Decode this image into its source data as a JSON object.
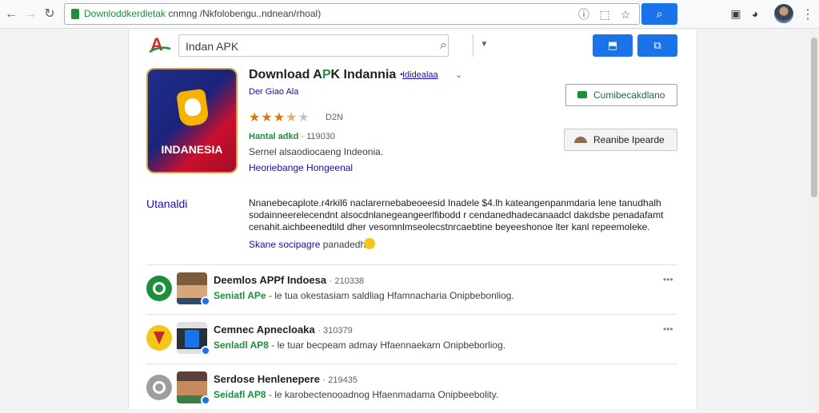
{
  "browser": {
    "url_host": "Downloddkerdletak",
    "url_path": " cnmng /Nkfolobengu..ndnean/rhoal)",
    "icons": [
      "back-arrow-icon",
      "forward-arrow-icon",
      "reload-icon",
      "security-lock-icon",
      "info-icon",
      "bookmark-icon",
      "star-icon",
      "search-icon",
      "extension-icon",
      "clock-icon",
      "profile-avatar",
      "menu-dots-icon"
    ]
  },
  "site": {
    "logo": "A",
    "search_value": "Indan APK",
    "colors": {
      "accent": "#1a73e8",
      "green": "#1e8e3e",
      "link": "#1a0dab",
      "star": "#e37400"
    }
  },
  "app": {
    "title_prefix": "Download A",
    "title_green": "P",
    "title_suffix": "K Indannia ·",
    "developer_link": "Ididealaa",
    "subtitle_link": "Der Giao Ala",
    "icon_text": "INDANESIA",
    "rating": 3.5,
    "rating_text": "D2N",
    "meta_green": "Hantal adkd",
    "meta_sep": " · 119030",
    "meta_line2": "Sernel alsaodiocaeng  Indeonia.",
    "meta_line3": "Heoriebange Hongeenal",
    "install_label": "Cumibecakdlano",
    "second_label": "Reanibe Ipearde"
  },
  "description": {
    "label": "Utanaldi",
    "lines": [
      "Nnanebecaplote.r4rkil6 naclarernebabeoeesid Inadele $4.lh kateangenpanmdaria lene tanudhalh",
      "sodainneerelecendnt alsocdnlanegeangeerlfibodd r cendanedhadecanaadcl dakdsbe penadafamt",
      "cenahit.aichbeenedtild dher vesomnlmseolecstnrcaebtine beyeeshonoe lter kanl repeemoleke."
    ],
    "more_link": "Skane socipagre",
    "more_text": " panadedh"
  },
  "list": [
    {
      "title": "Deemlos APPf Indoesa",
      "count": "· 210338",
      "sub_green": "Seniatl APe",
      "sub_text": " - le tua okestasiam saldliag Hfamnacharia Onipbebonliog."
    },
    {
      "title": "Cemnec Apnecloaka",
      "count": "· 310379",
      "sub_green": "Senladl AP8",
      "sub_text": " - le tuar becpeam admay Hfaennaekarn Onipbeborliog."
    },
    {
      "title": "Serdose Henlenepere",
      "count": "· 219435",
      "sub_green": "Seidafl AP8",
      "sub_text": " - le karobectenooadnog Hfaenmadama Onipbeebolity."
    }
  ]
}
